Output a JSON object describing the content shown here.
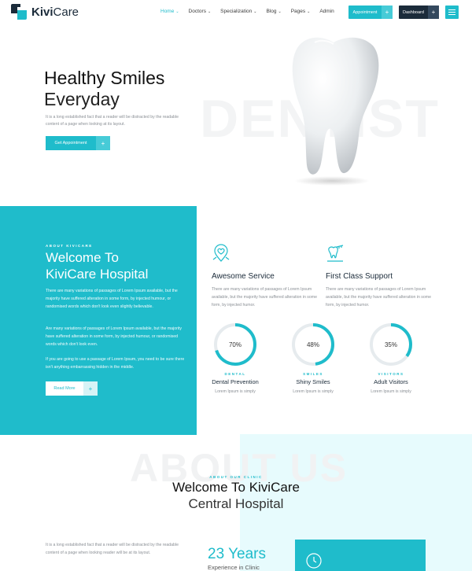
{
  "header": {
    "logo_bold": "Kivi",
    "logo_light": "Care",
    "nav": [
      {
        "label": "Home",
        "dropdown": true,
        "active": true
      },
      {
        "label": "Doctors",
        "dropdown": true,
        "active": false
      },
      {
        "label": "Specialization",
        "dropdown": true,
        "active": false
      },
      {
        "label": "Blog",
        "dropdown": true,
        "active": false
      },
      {
        "label": "Pages",
        "dropdown": true,
        "active": false
      },
      {
        "label": "Admin",
        "dropdown": false,
        "active": false
      }
    ],
    "appointment_button": "Appointment",
    "dashboard_button": "Dashboard",
    "plus": "+",
    "caret": "⌄"
  },
  "hero": {
    "title_line1": "Healthy Smiles",
    "title_line2": "Everyday",
    "description": "It is a long established fact that a reader will be distracted by the readable content of a page when looking at its layout.",
    "button": "Get Appointment",
    "watermark": "DENTIST"
  },
  "welcome": {
    "eyebrow": "ABOUT KIVICARE",
    "title_line1": "Welcome To",
    "title_line2": "KiviCare Hospital",
    "paragraphs": [
      "There are many variations of passages of Lorem Ipsum available, but the majority have suffered alteration in some form, by injected humour, or randomised words which don't look even slightly believable.",
      "Are many variations of passages of Lorem Ipsum available, but the majority have suffered alteration in some form, by injected humour, or randomised words which don't look even.",
      "If you are going to use a passage of Lorem Ipsum, you need to be sure there isn't anything embarrassing hidden in the middle."
    ],
    "button": "Read More"
  },
  "features": [
    {
      "title": "Awesome Service",
      "icon": "map-pin-heart-icon",
      "description": "There are many variations of passages of Lorem Ipsum available, but the majority have suffered alteration in some form, by injected humor."
    },
    {
      "title": "First Class Support",
      "icon": "dental-tools-icon",
      "description": "There are many variations of passages of Lorem Ipsum available, but the majority have suffered alteration in some form, by injected humor."
    }
  ],
  "stats": [
    {
      "value": 70,
      "label": "70%",
      "kicker": "DENTAL",
      "title": "Dental Prevention",
      "description": "Lorem Ipsum is simply"
    },
    {
      "value": 48,
      "label": "48%",
      "kicker": "SMILES",
      "title": "Shiny Smiles",
      "description": "Lorem Ipsum is simply"
    },
    {
      "value": 35,
      "label": "35%",
      "kicker": "VISITORS",
      "title": "Adult Visitors",
      "description": "Lorem Ipsum is simply"
    }
  ],
  "about": {
    "watermark": "ABOUT US",
    "eyebrow": "ABOUT OUR CLINIC",
    "title_line1": "Welcome To KiviCare",
    "title_line2": "Central Hospital",
    "description": "It is a long established fact that a reader will be distracted by the readable content of a page when looking reader will be at its layout.",
    "years": "23 Years",
    "years_sub": "Experience in Clinic"
  },
  "colors": {
    "accent": "#1fbccb",
    "dark": "#1b2b3a",
    "ring_track": "#e6ebee"
  }
}
